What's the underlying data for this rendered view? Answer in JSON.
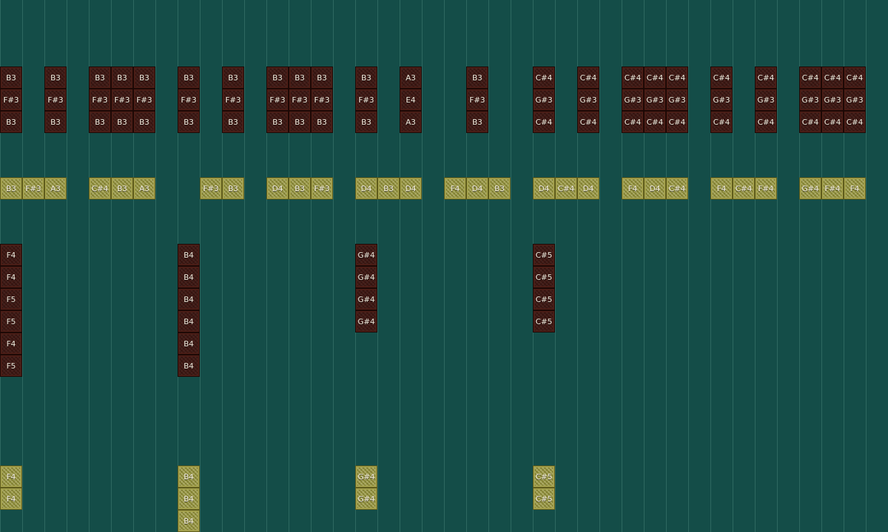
{
  "colors": {
    "background": "#144d48",
    "grid_line": "#2f6a62",
    "red_block": "#3e1712",
    "yellow_block": "#8e8e3c",
    "label_text": "#f4eee0"
  },
  "notes": [
    {
      "col": 0,
      "row": 0,
      "kind": "red",
      "label": "B3"
    },
    {
      "col": 0,
      "row": 1,
      "kind": "red",
      "label": "F#3"
    },
    {
      "col": 0,
      "row": 2,
      "kind": "red",
      "label": "B3"
    },
    {
      "col": 2,
      "row": 0,
      "kind": "red",
      "label": "B3"
    },
    {
      "col": 2,
      "row": 1,
      "kind": "red",
      "label": "F#3"
    },
    {
      "col": 2,
      "row": 2,
      "kind": "red",
      "label": "B3"
    },
    {
      "col": 4,
      "row": 0,
      "kind": "red",
      "label": "B3"
    },
    {
      "col": 4,
      "row": 1,
      "kind": "red",
      "label": "F#3"
    },
    {
      "col": 4,
      "row": 2,
      "kind": "red",
      "label": "B3"
    },
    {
      "col": 5,
      "row": 0,
      "kind": "red",
      "label": "B3"
    },
    {
      "col": 5,
      "row": 1,
      "kind": "red",
      "label": "F#3"
    },
    {
      "col": 5,
      "row": 2,
      "kind": "red",
      "label": "B3"
    },
    {
      "col": 6,
      "row": 0,
      "kind": "red",
      "label": "B3"
    },
    {
      "col": 6,
      "row": 1,
      "kind": "red",
      "label": "F#3"
    },
    {
      "col": 6,
      "row": 2,
      "kind": "red",
      "label": "B3"
    },
    {
      "col": 8,
      "row": 0,
      "kind": "red",
      "label": "B3"
    },
    {
      "col": 8,
      "row": 1,
      "kind": "red",
      "label": "F#3"
    },
    {
      "col": 8,
      "row": 2,
      "kind": "red",
      "label": "B3"
    },
    {
      "col": 10,
      "row": 0,
      "kind": "red",
      "label": "B3"
    },
    {
      "col": 10,
      "row": 1,
      "kind": "red",
      "label": "F#3"
    },
    {
      "col": 10,
      "row": 2,
      "kind": "red",
      "label": "B3"
    },
    {
      "col": 12,
      "row": 0,
      "kind": "red",
      "label": "B3"
    },
    {
      "col": 12,
      "row": 1,
      "kind": "red",
      "label": "F#3"
    },
    {
      "col": 12,
      "row": 2,
      "kind": "red",
      "label": "B3"
    },
    {
      "col": 13,
      "row": 0,
      "kind": "red",
      "label": "B3"
    },
    {
      "col": 13,
      "row": 1,
      "kind": "red",
      "label": "F#3"
    },
    {
      "col": 13,
      "row": 2,
      "kind": "red",
      "label": "B3"
    },
    {
      "col": 14,
      "row": 0,
      "kind": "red",
      "label": "B3"
    },
    {
      "col": 14,
      "row": 1,
      "kind": "red",
      "label": "F#3"
    },
    {
      "col": 14,
      "row": 2,
      "kind": "red",
      "label": "B3"
    },
    {
      "col": 16,
      "row": 0,
      "kind": "red",
      "label": "B3"
    },
    {
      "col": 16,
      "row": 1,
      "kind": "red",
      "label": "F#3"
    },
    {
      "col": 16,
      "row": 2,
      "kind": "red",
      "label": "B3"
    },
    {
      "col": 18,
      "row": 0,
      "kind": "red",
      "label": "A3"
    },
    {
      "col": 18,
      "row": 1,
      "kind": "red",
      "label": "E4"
    },
    {
      "col": 18,
      "row": 2,
      "kind": "red",
      "label": "A3"
    },
    {
      "col": 21,
      "row": 0,
      "kind": "red",
      "label": "B3"
    },
    {
      "col": 21,
      "row": 1,
      "kind": "red",
      "label": "F#3"
    },
    {
      "col": 21,
      "row": 2,
      "kind": "red",
      "label": "B3"
    },
    {
      "col": 24,
      "row": 0,
      "kind": "red",
      "label": "C#4"
    },
    {
      "col": 24,
      "row": 1,
      "kind": "red",
      "label": "G#3"
    },
    {
      "col": 24,
      "row": 2,
      "kind": "red",
      "label": "C#4"
    },
    {
      "col": 26,
      "row": 0,
      "kind": "red",
      "label": "C#4"
    },
    {
      "col": 26,
      "row": 1,
      "kind": "red",
      "label": "G#3"
    },
    {
      "col": 26,
      "row": 2,
      "kind": "red",
      "label": "C#4"
    },
    {
      "col": 28,
      "row": 0,
      "kind": "red",
      "label": "C#4"
    },
    {
      "col": 28,
      "row": 1,
      "kind": "red",
      "label": "G#3"
    },
    {
      "col": 28,
      "row": 2,
      "kind": "red",
      "label": "C#4"
    },
    {
      "col": 29,
      "row": 0,
      "kind": "red",
      "label": "C#4"
    },
    {
      "col": 29,
      "row": 1,
      "kind": "red",
      "label": "G#3"
    },
    {
      "col": 29,
      "row": 2,
      "kind": "red",
      "label": "C#4"
    },
    {
      "col": 30,
      "row": 0,
      "kind": "red",
      "label": "C#4"
    },
    {
      "col": 30,
      "row": 1,
      "kind": "red",
      "label": "G#3"
    },
    {
      "col": 30,
      "row": 2,
      "kind": "red",
      "label": "C#4"
    },
    {
      "col": 32,
      "row": 0,
      "kind": "red",
      "label": "C#4"
    },
    {
      "col": 32,
      "row": 1,
      "kind": "red",
      "label": "G#3"
    },
    {
      "col": 32,
      "row": 2,
      "kind": "red",
      "label": "C#4"
    },
    {
      "col": 34,
      "row": 0,
      "kind": "red",
      "label": "C#4"
    },
    {
      "col": 34,
      "row": 1,
      "kind": "red",
      "label": "G#3"
    },
    {
      "col": 34,
      "row": 2,
      "kind": "red",
      "label": "C#4"
    },
    {
      "col": 36,
      "row": 0,
      "kind": "red",
      "label": "C#4"
    },
    {
      "col": 36,
      "row": 1,
      "kind": "red",
      "label": "G#3"
    },
    {
      "col": 36,
      "row": 2,
      "kind": "red",
      "label": "C#4"
    },
    {
      "col": 37,
      "row": 0,
      "kind": "red",
      "label": "C#4"
    },
    {
      "col": 37,
      "row": 1,
      "kind": "red",
      "label": "G#3"
    },
    {
      "col": 37,
      "row": 2,
      "kind": "red",
      "label": "C#4"
    },
    {
      "col": 38,
      "row": 0,
      "kind": "red",
      "label": "C#4"
    },
    {
      "col": 38,
      "row": 1,
      "kind": "red",
      "label": "G#3"
    },
    {
      "col": 38,
      "row": 2,
      "kind": "red",
      "label": "C#4"
    },
    {
      "col": 0,
      "row": 5,
      "kind": "yellow",
      "label": "B3"
    },
    {
      "col": 1,
      "row": 5,
      "kind": "yellow",
      "label": "F#3"
    },
    {
      "col": 2,
      "row": 5,
      "kind": "yellow",
      "label": "A3"
    },
    {
      "col": 4,
      "row": 5,
      "kind": "yellow",
      "label": "C#4"
    },
    {
      "col": 5,
      "row": 5,
      "kind": "yellow",
      "label": "B3"
    },
    {
      "col": 6,
      "row": 5,
      "kind": "yellow",
      "label": "A3"
    },
    {
      "col": 9,
      "row": 5,
      "kind": "yellow",
      "label": "F#3"
    },
    {
      "col": 10,
      "row": 5,
      "kind": "yellow",
      "label": "B3"
    },
    {
      "col": 12,
      "row": 5,
      "kind": "yellow",
      "label": "D4"
    },
    {
      "col": 13,
      "row": 5,
      "kind": "yellow",
      "label": "B3"
    },
    {
      "col": 14,
      "row": 5,
      "kind": "yellow",
      "label": "F#3"
    },
    {
      "col": 16,
      "row": 5,
      "kind": "yellow",
      "label": "D4"
    },
    {
      "col": 17,
      "row": 5,
      "kind": "yellow",
      "label": "B3"
    },
    {
      "col": 18,
      "row": 5,
      "kind": "yellow",
      "label": "D4"
    },
    {
      "col": 20,
      "row": 5,
      "kind": "yellow",
      "label": "F4"
    },
    {
      "col": 21,
      "row": 5,
      "kind": "yellow",
      "label": "D4"
    },
    {
      "col": 22,
      "row": 5,
      "kind": "yellow",
      "label": "B3"
    },
    {
      "col": 24,
      "row": 5,
      "kind": "yellow",
      "label": "D4"
    },
    {
      "col": 25,
      "row": 5,
      "kind": "yellow",
      "label": "C#4"
    },
    {
      "col": 26,
      "row": 5,
      "kind": "yellow",
      "label": "D4"
    },
    {
      "col": 28,
      "row": 5,
      "kind": "yellow",
      "label": "F4"
    },
    {
      "col": 29,
      "row": 5,
      "kind": "yellow",
      "label": "D4"
    },
    {
      "col": 30,
      "row": 5,
      "kind": "yellow",
      "label": "C#4"
    },
    {
      "col": 32,
      "row": 5,
      "kind": "yellow",
      "label": "F4"
    },
    {
      "col": 33,
      "row": 5,
      "kind": "yellow",
      "label": "C#4"
    },
    {
      "col": 34,
      "row": 5,
      "kind": "yellow",
      "label": "F#4"
    },
    {
      "col": 36,
      "row": 5,
      "kind": "yellow",
      "label": "G#4"
    },
    {
      "col": 37,
      "row": 5,
      "kind": "yellow",
      "label": "F#4"
    },
    {
      "col": 38,
      "row": 5,
      "kind": "yellow",
      "label": "F4"
    },
    {
      "col": 0,
      "row": 8,
      "kind": "red",
      "label": "F4"
    },
    {
      "col": 0,
      "row": 9,
      "kind": "red",
      "label": "F4"
    },
    {
      "col": 0,
      "row": 10,
      "kind": "red",
      "label": "F5"
    },
    {
      "col": 0,
      "row": 11,
      "kind": "red",
      "label": "F5"
    },
    {
      "col": 0,
      "row": 12,
      "kind": "red",
      "label": "F4"
    },
    {
      "col": 0,
      "row": 13,
      "kind": "red",
      "label": "F5"
    },
    {
      "col": 8,
      "row": 8,
      "kind": "red",
      "label": "B4"
    },
    {
      "col": 8,
      "row": 9,
      "kind": "red",
      "label": "B4"
    },
    {
      "col": 8,
      "row": 10,
      "kind": "red",
      "label": "B4"
    },
    {
      "col": 8,
      "row": 11,
      "kind": "red",
      "label": "B4"
    },
    {
      "col": 8,
      "row": 12,
      "kind": "red",
      "label": "B4"
    },
    {
      "col": 8,
      "row": 13,
      "kind": "red",
      "label": "B4"
    },
    {
      "col": 16,
      "row": 8,
      "kind": "red",
      "label": "G#4"
    },
    {
      "col": 16,
      "row": 9,
      "kind": "red",
      "label": "G#4"
    },
    {
      "col": 16,
      "row": 10,
      "kind": "red",
      "label": "G#4"
    },
    {
      "col": 16,
      "row": 11,
      "kind": "red",
      "label": "G#4"
    },
    {
      "col": 24,
      "row": 8,
      "kind": "red",
      "label": "C#5"
    },
    {
      "col": 24,
      "row": 9,
      "kind": "red",
      "label": "C#5"
    },
    {
      "col": 24,
      "row": 10,
      "kind": "red",
      "label": "C#5"
    },
    {
      "col": 24,
      "row": 11,
      "kind": "red",
      "label": "C#5"
    },
    {
      "col": 0,
      "row": 18,
      "kind": "yellow",
      "label": "F4"
    },
    {
      "col": 0,
      "row": 19,
      "kind": "yellow",
      "label": "F4"
    },
    {
      "col": 8,
      "row": 18,
      "kind": "yellow",
      "label": "B4"
    },
    {
      "col": 8,
      "row": 19,
      "kind": "yellow",
      "label": "B4"
    },
    {
      "col": 8,
      "row": 20,
      "kind": "yellow",
      "label": "B4"
    },
    {
      "col": 16,
      "row": 18,
      "kind": "yellow",
      "label": "G#4"
    },
    {
      "col": 16,
      "row": 19,
      "kind": "yellow",
      "label": "G#4"
    },
    {
      "col": 24,
      "row": 18,
      "kind": "yellow",
      "label": "C#5"
    },
    {
      "col": 24,
      "row": 19,
      "kind": "yellow",
      "label": "C#5"
    }
  ]
}
